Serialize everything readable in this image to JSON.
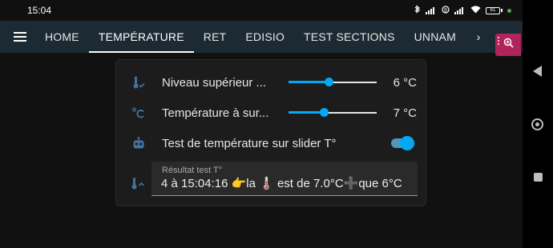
{
  "status_bar": {
    "time": "15:04",
    "battery": "61"
  },
  "top_bar": {
    "tabs": [
      {
        "label": "HOME"
      },
      {
        "label": "TEMPÉRATURE"
      },
      {
        "label": "RET"
      },
      {
        "label": "EDISIO"
      },
      {
        "label": "TEST SECTIONS"
      },
      {
        "label": "UNNAM"
      }
    ],
    "more_arrow": "›"
  },
  "card": {
    "rows": [
      {
        "label": "Niveau supérieur ...",
        "value": "6 °C",
        "slider_fraction": 0.45
      },
      {
        "label": "Température à sur...",
        "value": "7 °C",
        "slider_fraction": 0.4
      },
      {
        "label": "Test de température sur slider T°",
        "toggle_on": true
      }
    ],
    "input": {
      "label": "Résultat test T°",
      "value": "4 à 15:04:16 👉la 🌡️ est de 7.0°C➕que  6°C"
    }
  },
  "colors": {
    "accent": "#03a9f4",
    "toolbar": "#1c2b33",
    "fab": "#b0245a",
    "icon": "#44739e"
  },
  "icons": {
    "row1": "thermometer-check-icon",
    "row2": "celsius-icon",
    "row3": "robot-icon",
    "row4": "thermometer-chevron-up-icon",
    "fab": "zoom-in-icon"
  }
}
